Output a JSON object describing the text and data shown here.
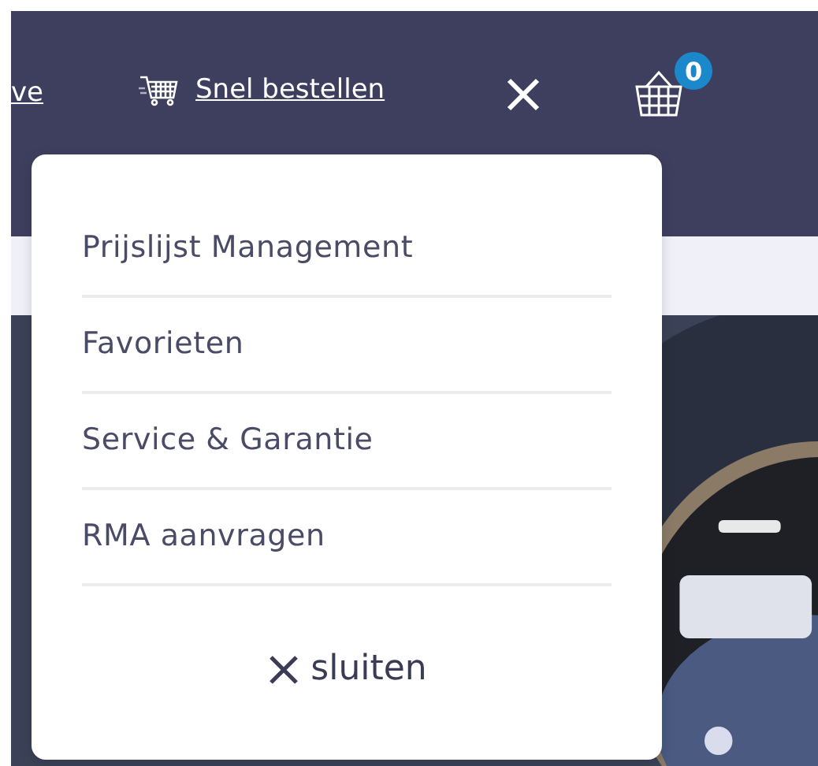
{
  "header": {
    "link_partial": "ve",
    "quick_order": "Snel bestellen",
    "cart": {
      "count": "0"
    }
  },
  "menu": {
    "items": [
      {
        "label": "Prijslijst Management"
      },
      {
        "label": "Favorieten"
      },
      {
        "label": "Service & Garantie"
      },
      {
        "label": "RMA aanvragen"
      }
    ],
    "close_label": "sluiten"
  }
}
